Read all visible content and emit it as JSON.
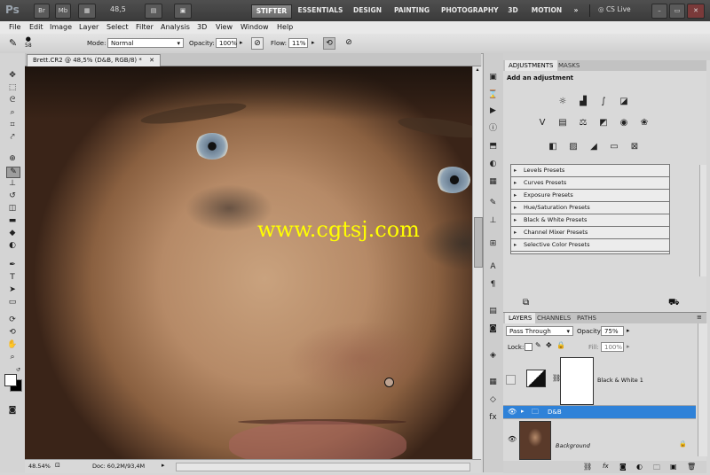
{
  "app": {
    "logo": "Ps",
    "left_buttons": [
      "Br",
      "Mb"
    ],
    "zoom": "48,5",
    "workspaces": [
      "STIFTER",
      "ESSENTIALS",
      "DESIGN",
      "PAINTING",
      "PHOTOGRAPHY",
      "3D",
      "MOTION"
    ],
    "more": "»",
    "cslive": "CS Live"
  },
  "menu": [
    "File",
    "Edit",
    "Image",
    "Layer",
    "Select",
    "Filter",
    "Analysis",
    "3D",
    "View",
    "Window",
    "Help"
  ],
  "options": {
    "brush_size": "58",
    "mode_label": "Mode:",
    "mode_value": "Normal",
    "opacity_label": "Opacity:",
    "opacity_value": "100%",
    "flow_label": "Flow:",
    "flow_value": "11%"
  },
  "document": {
    "tab_title": "Brett.CR2 @ 48,5% (D&B, RGB/8) *",
    "watermark": "www.cgtsj.com",
    "zoom_status": "48.54%",
    "doc_status": "Doc: 60,2M/93,4M"
  },
  "adjustments": {
    "tabs": [
      "ADJUSTMENTS",
      "MASKS"
    ],
    "heading": "Add an adjustment",
    "presets": [
      "Levels Presets",
      "Curves Presets",
      "Exposure Presets",
      "Hue/Saturation Presets",
      "Black & White Presets",
      "Channel Mixer Presets",
      "Selective Color Presets"
    ]
  },
  "layers": {
    "tabs": [
      "LAYERS",
      "CHANNELS",
      "PATHS"
    ],
    "blend_mode": "Pass Through",
    "opacity_label": "Opacity:",
    "opacity_value": "75%",
    "lock_label": "Lock:",
    "fill_label": "Fill:",
    "fill_value": "100%",
    "items": [
      {
        "name": "Black & White 1"
      },
      {
        "name": "D&B"
      },
      {
        "name": "Background"
      }
    ]
  },
  "colors": {
    "selected_layer": "#2f82d8",
    "watermark": "#ffff00",
    "app_bar": "#3a3a3a"
  }
}
